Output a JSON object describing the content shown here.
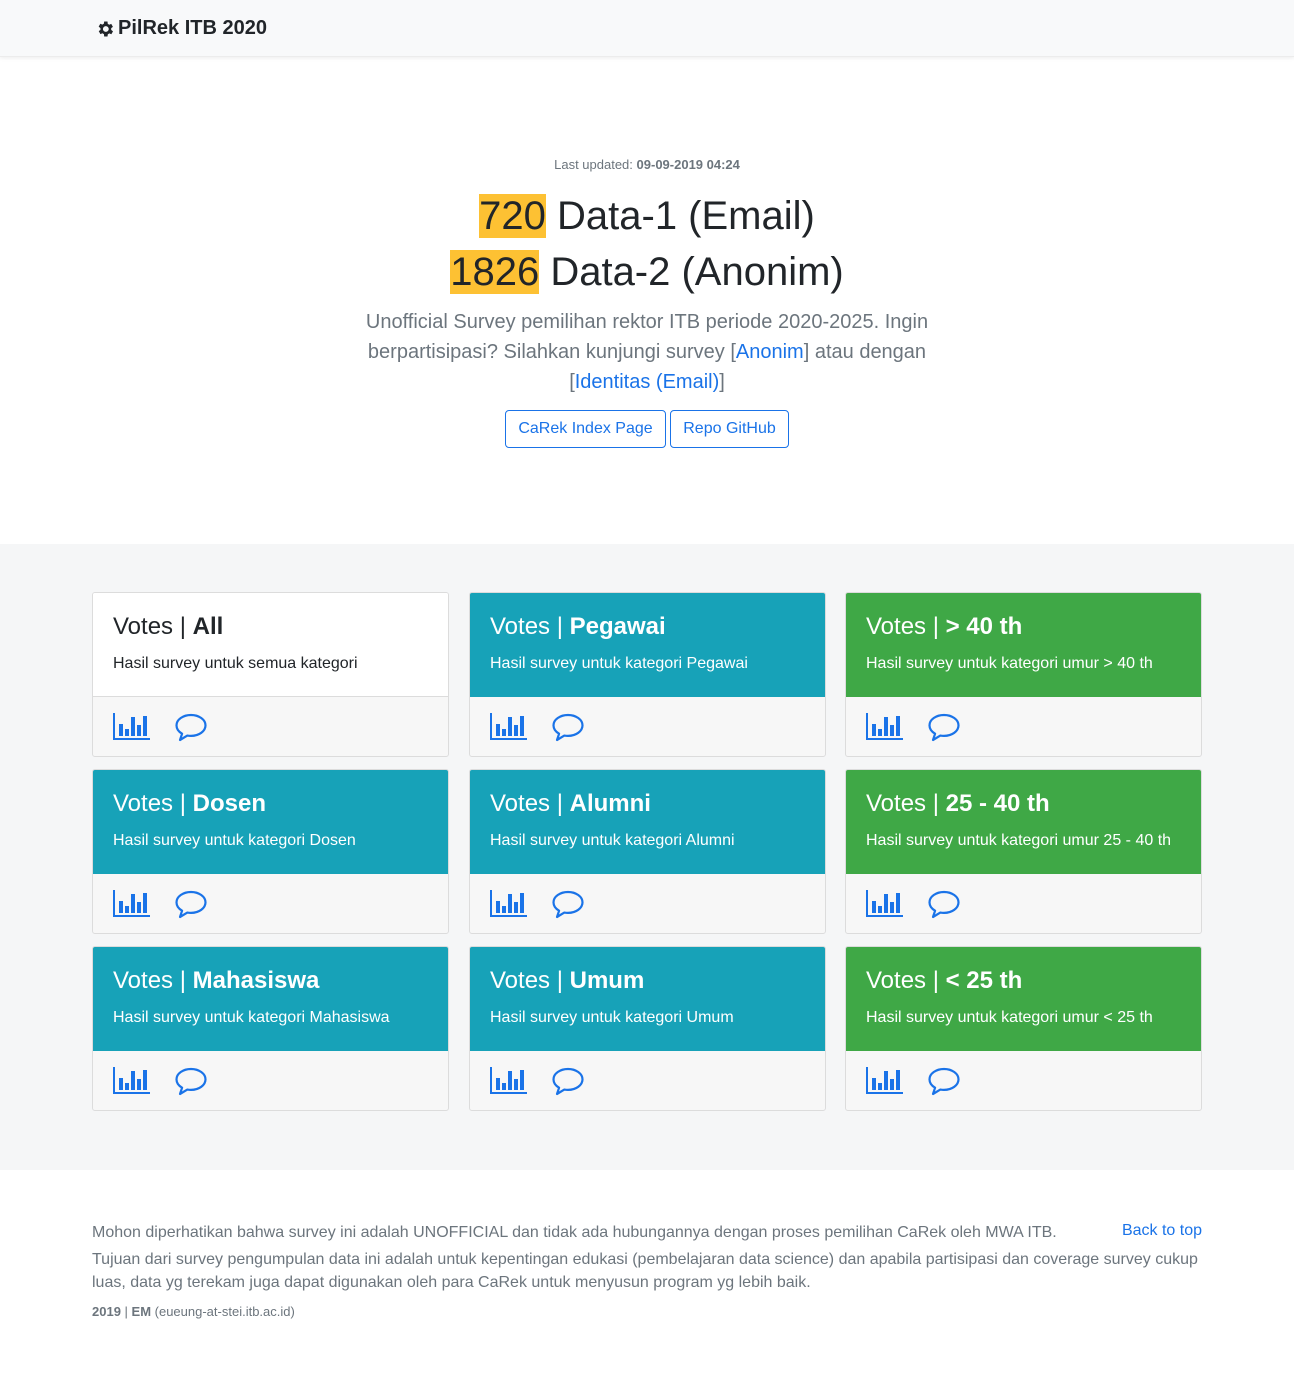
{
  "nav": {
    "brand": "PilRek ITB 2020",
    "brand_icon": "gear-icon"
  },
  "hero": {
    "last_updated_label": "Last updated:",
    "last_updated_value": "09-09-2019 04:24",
    "line1_count": "720",
    "line1_label": " Data-1 (Email)",
    "line2_count": "1826",
    "line2_label": " Data-2 (Anonim)",
    "lead_text_1": "Unofficial Survey pemilihan rektor ITB periode 2020-2025. Ingin berpartisipasi? Silahkan kunjungi survey [",
    "lead_link_1": "Anonim",
    "lead_text_2": "] atau dengan [",
    "lead_link_2": "Identitas (Email)",
    "lead_text_3": "]",
    "button_1": "CaRek Index Page",
    "button_2": "Repo GitHub",
    "highlight_color": "#fdc133"
  },
  "cards": [
    {
      "prefix": "Votes | ",
      "title": "All",
      "text": "Hasil survey untuk semua kategori",
      "style": "white"
    },
    {
      "prefix": "Votes | ",
      "title": "Pegawai",
      "text": "Hasil survey untuk kategori Pegawai",
      "style": "teal"
    },
    {
      "prefix": "Votes | ",
      "title": "> 40 th",
      "text": "Hasil survey untuk kategori umur > 40 th",
      "style": "green"
    },
    {
      "prefix": "Votes | ",
      "title": "Dosen",
      "text": "Hasil survey untuk kategori Dosen",
      "style": "teal"
    },
    {
      "prefix": "Votes | ",
      "title": "Alumni",
      "text": "Hasil survey untuk kategori Alumni",
      "style": "teal"
    },
    {
      "prefix": "Votes | ",
      "title": "25 - 40 th",
      "text": "Hasil survey untuk kategori umur 25 - 40 th",
      "style": "green"
    },
    {
      "prefix": "Votes | ",
      "title": "Mahasiswa",
      "text": "Hasil survey untuk kategori Mahasiswa",
      "style": "teal"
    },
    {
      "prefix": "Votes | ",
      "title": "Umum",
      "text": "Hasil survey untuk kategori Umum",
      "style": "teal"
    },
    {
      "prefix": "Votes | ",
      "title": "< 25 th",
      "text": "Hasil survey untuk kategori umur < 25 th",
      "style": "green"
    }
  ],
  "card_icons": [
    "bar-chart-icon",
    "speech-bubble-icon"
  ],
  "colors": {
    "teal": "#17a2b8",
    "green": "#3fa846",
    "link": "#1a73e8"
  },
  "footer": {
    "notice": "Mohon diperhatikan bahwa survey ini adalah UNOFFICIAL dan tidak ada hubungannya dengan proses pemilihan CaRek oleh MWA ITB.",
    "back_to_top": "Back to top",
    "purpose": "Tujuan dari survey pengumpulan data ini adalah untuk kepentingan edukasi (pembelajaran data science) dan apabila partisipasi dan coverage survey cukup luas, data yg terekam juga dapat digunakan oleh para CaRek untuk menyusun program yg lebih baik.",
    "year": "2019",
    "separator": " | ",
    "author": "EM",
    "contact": " (eueung-at-stei.itb.ac.id)"
  }
}
